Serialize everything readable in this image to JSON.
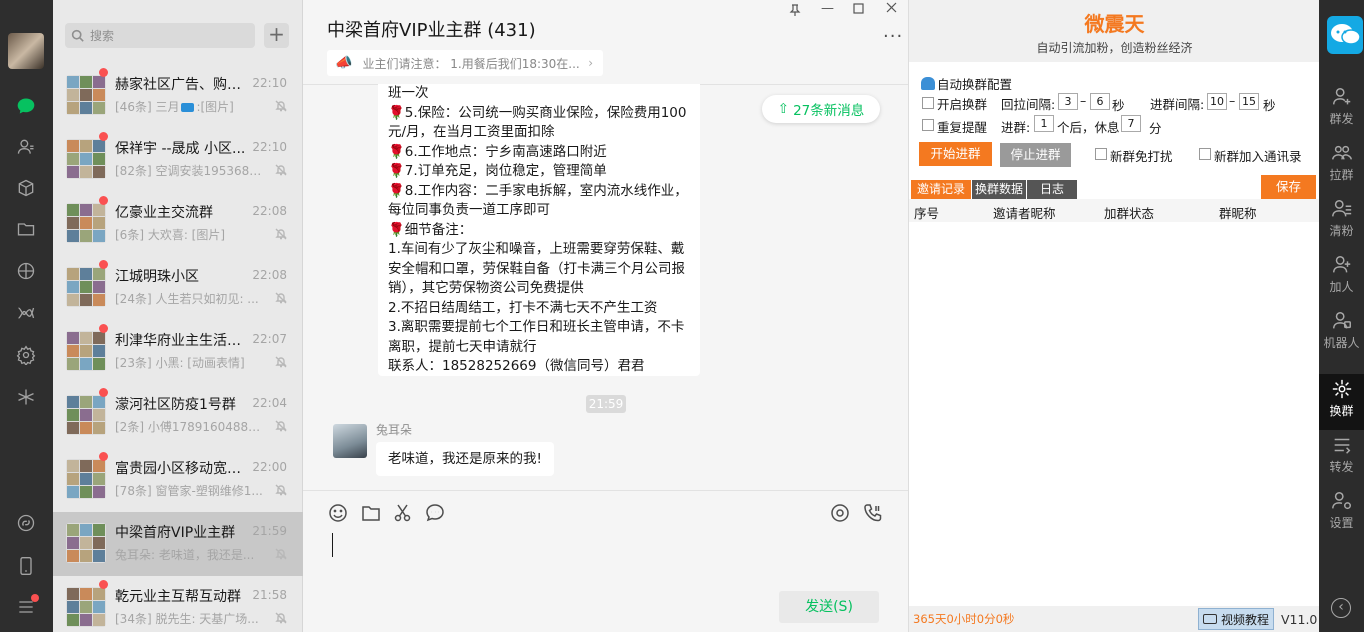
{
  "sidebar": {
    "nav_icons": [
      "chat-icon",
      "contacts-icon",
      "box-icon",
      "folder-icon",
      "moments-icon",
      "channels-icon",
      "settings-cog-icon",
      "mini-program-icon",
      "link-icon",
      "phone-icon",
      "menu-icon"
    ]
  },
  "chat_list": {
    "search_placeholder": "搜索",
    "add_label": "+",
    "items": [
      {
        "name": "赫家社区广告、购物...",
        "time": "22:10",
        "preview": "[46条] 三月",
        "preview_tail": ":[图片]",
        "selected": false
      },
      {
        "name": "保祥宇 --晟成 小区...",
        "time": "22:10",
        "preview": "[82条] 空调安装1953688...",
        "selected": false
      },
      {
        "name": "亿豪业主交流群",
        "time": "22:08",
        "preview": "[6条] 大欢喜: [图片]",
        "selected": false
      },
      {
        "name": "江城明珠小区",
        "time": "22:08",
        "preview": "[24条] 人生若只如初见: ...",
        "selected": false
      },
      {
        "name": "利津华府业主生活服...",
        "time": "22:07",
        "preview": "[23条] 小黑: [动画表情]",
        "selected": false
      },
      {
        "name": "濛河社区防疫1号群",
        "time": "22:04",
        "preview": "[2条] 小傅17891604882...",
        "selected": false
      },
      {
        "name": "富贵园小区移动宽带...",
        "time": "22:00",
        "preview": "[78条] 窗管家-塑钢维修1...",
        "selected": false
      },
      {
        "name": "中梁首府VIP业主群",
        "time": "21:59",
        "preview": "兔耳朵: 老味道，我还是...",
        "selected": true
      },
      {
        "name": "乾元业主互帮互动群",
        "time": "21:58",
        "preview": "[34条] 脱先生: 天基广场...",
        "selected": false
      }
    ]
  },
  "chat": {
    "title": "中梁首府VIP业主群 (431)",
    "more": "···",
    "window_controls": [
      "pin-icon",
      "minimize-icon",
      "maximize-icon",
      "close-icon"
    ],
    "notice": "业主们请注意： 1.用餐后我们18:30在...",
    "new_messages": "27条新消息",
    "message1": [
      "班一次",
      "🌹5.保险：公司统一购买商业保险，保险费用100元/月，在当月工资里面扣除",
      "🌹6.工作地点：宁乡南高速路口附近",
      "🌹7.订单充足，岗位稳定，管理简单",
      "🌹8.工作内容：二手家电拆解，室内流水线作业，每位同事负责一道工序即可",
      "🌹细节备注：",
      "1.车间有少了灰尘和噪音，上班需要穿劳保鞋、戴安全帽和口罩，劳保鞋自备（打卡满三个月公司报销），其它劳保物资公司免费提供",
      "2.不招日结周结工，打卡不满七天不产生工资",
      "3.离职需要提前七个工作日和班长主管申请，不卡离职，提前七天申请就行",
      "联系人：18528252669（微信同号）君君"
    ],
    "time_divider": "21:59",
    "sender": "兔耳朵",
    "message2": "老味道，我还是原来的我!",
    "send_label": "发送(S)"
  },
  "panel": {
    "brand": "微震天",
    "slogan": "自动引流加粉，创造粉丝经济",
    "section": "自动换群配置",
    "enable_switch": "开启换群",
    "pull_interval": "回拉间隔:",
    "pull_min": "3",
    "pull_max": "6",
    "sec1": "秒",
    "join_interval": "进群间隔:",
    "join_min": "10",
    "join_max": "15",
    "sec2": "秒",
    "repeat_remind": "重复提醒",
    "join_label": "进群:",
    "join_count": "1",
    "after_rest": "个后，休息",
    "rest_value": "7",
    "minute": "分",
    "start_btn": "开始进群",
    "stop_btn": "停止进群",
    "new_group_quiet": "新群免打扰",
    "new_group_contacts": "新群加入通讯录",
    "tabs": [
      "邀请记录",
      "换群数据",
      "日志"
    ],
    "save_btn": "保存",
    "columns": [
      "序号",
      "邀请者昵称",
      "加群状态",
      "群昵称"
    ],
    "footer_time": "365天0小时0分0秒",
    "video_btn": "视频教程",
    "version": "V11.0",
    "brand_color": "#f47920"
  },
  "right_toolbar": {
    "items": [
      {
        "label": "群发",
        "icon": "broadcast-icon"
      },
      {
        "label": "拉群",
        "icon": "pull-group-icon"
      },
      {
        "label": "清粉",
        "icon": "clean-fans-icon"
      },
      {
        "label": "加人",
        "icon": "add-person-icon"
      },
      {
        "label": "机器人",
        "icon": "robot-icon"
      },
      {
        "label": "换群",
        "icon": "switch-group-icon"
      },
      {
        "label": "转发",
        "icon": "forward-icon"
      },
      {
        "label": "设置",
        "icon": "settings-icon"
      }
    ]
  }
}
